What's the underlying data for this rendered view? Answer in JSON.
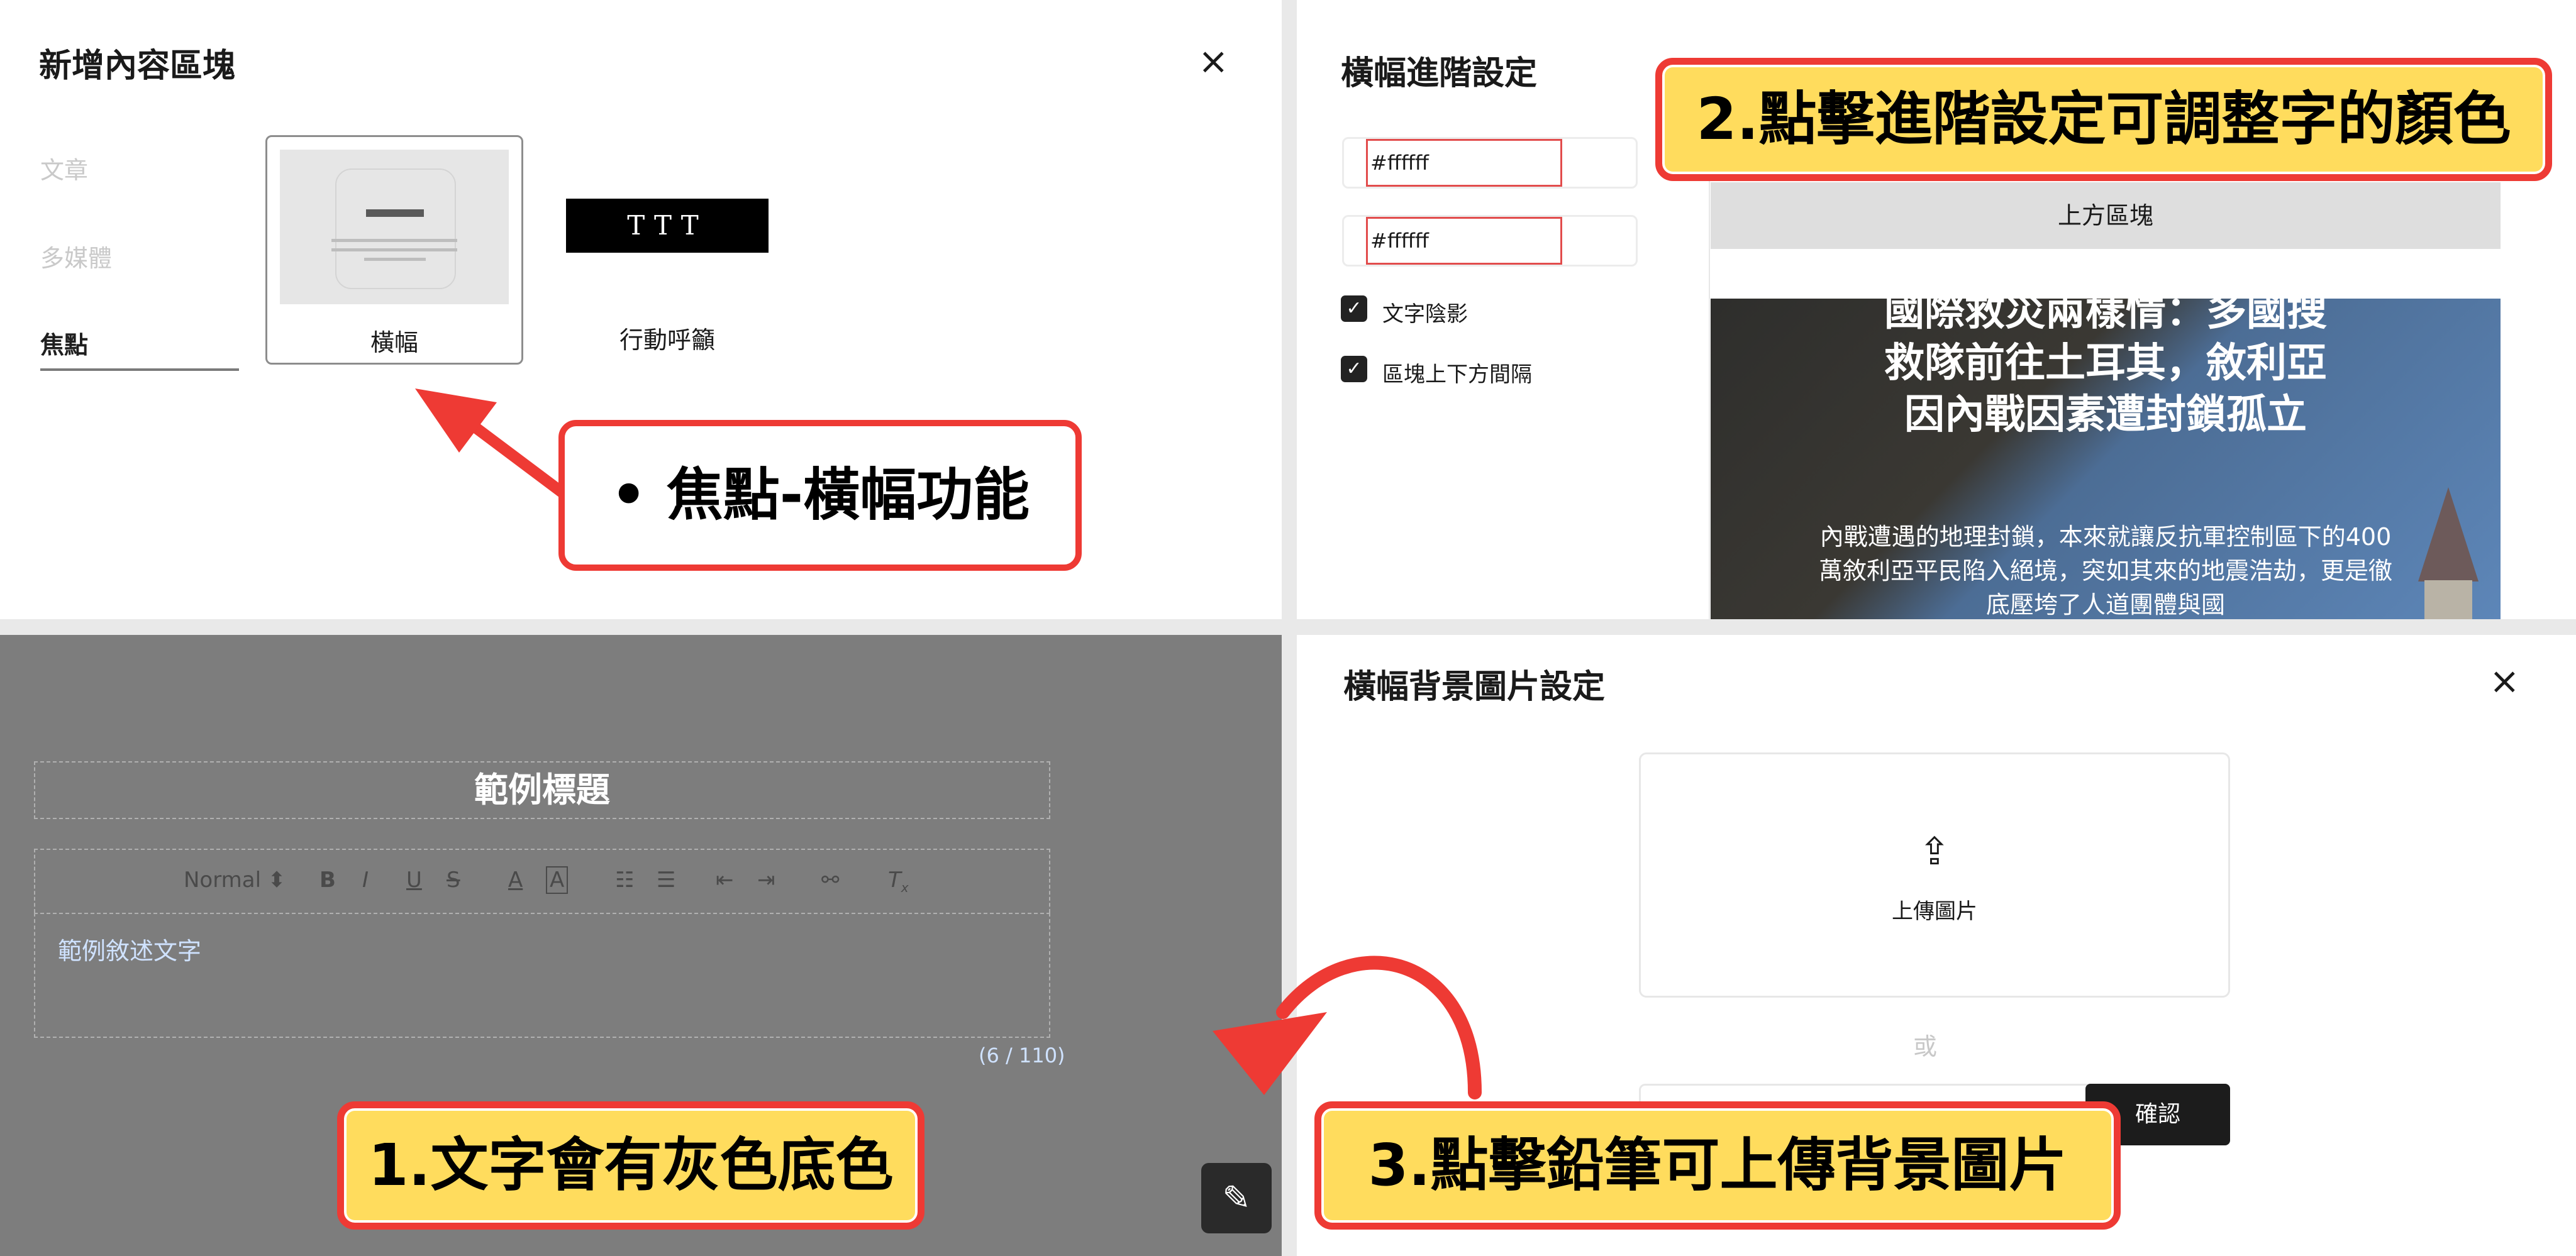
{
  "add_block_panel": {
    "title": "新增內容區塊",
    "close_icon": "×",
    "categories": [
      "文章",
      "多媒體",
      "焦點"
    ],
    "active_category": "焦點",
    "options": [
      {
        "label": "橫幅"
      },
      {
        "label": "行動呼籲",
        "preview_text": "TTT"
      }
    ]
  },
  "advanced_panel": {
    "title": "橫幅進階設定",
    "color_fields": [
      "#ffffff",
      "#ffffff"
    ],
    "checkboxes": [
      {
        "label": "文字陰影",
        "checked": true
      },
      {
        "label": "區塊上下方間隔",
        "checked": true
      }
    ],
    "top_block_label": "上方區塊",
    "banner_title": "國際救災兩樣情：多國搜救隊前往土耳其，敘利亞因內戰因素遭封鎖孤立",
    "banner_desc": "內戰遭遇的地理封鎖，本來就讓反抗軍控制區下的400萬敘利亞平民陷入絕境，突如其來的地震浩劫，更是徹底壓垮了人道團體與國"
  },
  "editor_panel": {
    "title": "範例標題",
    "toolbar": {
      "format": "Normal",
      "tools": [
        "B",
        "I",
        "U",
        "S",
        "A",
        "A",
        "ordered-list",
        "bullet-list",
        "outdent",
        "indent",
        "link",
        "clear-format"
      ]
    },
    "body_text": "範例敘述文字",
    "counter": "(6 / 110)",
    "edit_icon": "pencil-edit-icon"
  },
  "bg_image_panel": {
    "title": "橫幅背景圖片設定",
    "close_icon": "×",
    "upload_label": "上傳圖片",
    "or_text": "或",
    "confirm_label": "確認"
  },
  "callouts": {
    "banner_feature": "焦點-橫幅功能",
    "step1": "1.文字會有灰色底色",
    "step2": "2.點擊進階設定可調整字的顏色",
    "step3": "3.點擊鉛筆可上傳背景圖片"
  },
  "colors": {
    "callout_border": "#ee3a34",
    "callout_fill": "#ffdc5d",
    "editor_bg": "#7d7d7d"
  }
}
